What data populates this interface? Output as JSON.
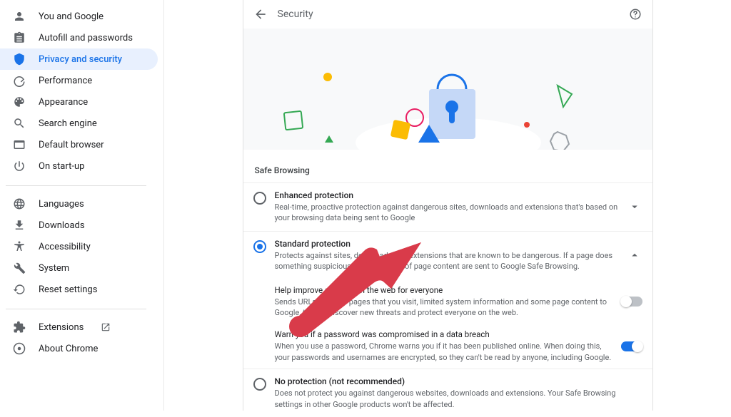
{
  "sidebar": {
    "groups": [
      [
        {
          "id": "you-google",
          "label": "You and Google"
        },
        {
          "id": "autofill",
          "label": "Autofill and passwords"
        },
        {
          "id": "privacy",
          "label": "Privacy and security",
          "active": true
        },
        {
          "id": "performance",
          "label": "Performance"
        },
        {
          "id": "appearance",
          "label": "Appearance"
        },
        {
          "id": "search",
          "label": "Search engine"
        },
        {
          "id": "default",
          "label": "Default browser"
        },
        {
          "id": "startup",
          "label": "On start-up"
        }
      ],
      [
        {
          "id": "languages",
          "label": "Languages"
        },
        {
          "id": "downloads",
          "label": "Downloads"
        },
        {
          "id": "accessibility",
          "label": "Accessibility"
        },
        {
          "id": "system",
          "label": "System"
        },
        {
          "id": "reset",
          "label": "Reset settings"
        }
      ],
      [
        {
          "id": "extensions",
          "label": "Extensions",
          "external": true
        },
        {
          "id": "about",
          "label": "About Chrome"
        }
      ]
    ]
  },
  "header": {
    "title": "Security"
  },
  "section_title": "Safe Browsing",
  "options": {
    "enhanced": {
      "title": "Enhanced protection",
      "desc": "Real-time, proactive protection against dangerous sites, downloads and extensions that's based on your browsing data being sent to Google"
    },
    "standard": {
      "title": "Standard protection",
      "desc": "Protects against sites, downloads and extensions that are known to be dangerous. If a page does something suspicious, URLs and bits of page content are sent to Google Safe Browsing."
    },
    "none": {
      "title": "No protection (not recommended)",
      "desc": "Does not protect you against dangerous websites, downloads and extensions. Your Safe Browsing settings in other Google products won't be affected."
    }
  },
  "subs": {
    "improve": {
      "title": "Help improve security on the web for everyone",
      "desc": "Sends URLs of some pages that you visit, limited system information and some page content to Google, to help discover new threats and protect everyone on the web.",
      "on": false
    },
    "warn": {
      "title": "Warn you if a password was compromised in a data breach",
      "desc": "When you use a password, Chrome warns you if it has been published online. When doing this, your passwords and usernames are encrypted, so they can't be read by anyone, including Google.",
      "on": true
    }
  }
}
